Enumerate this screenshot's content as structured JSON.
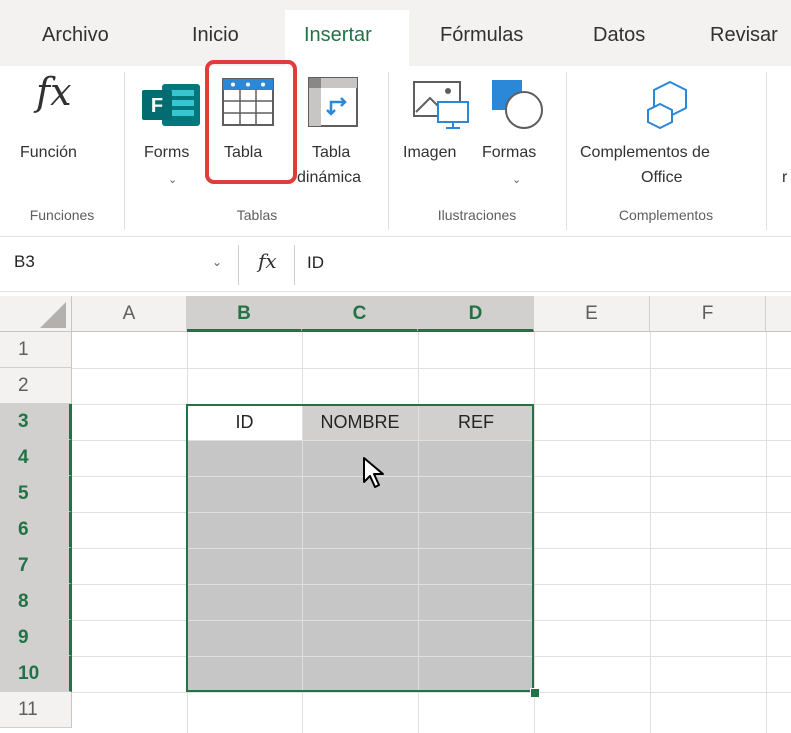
{
  "tabs": [
    {
      "label": "Archivo",
      "active": false
    },
    {
      "label": "Inicio",
      "active": false
    },
    {
      "label": "Insertar",
      "active": true
    },
    {
      "label": "Fórmulas",
      "active": false
    },
    {
      "label": "Datos",
      "active": false
    },
    {
      "label": "Revisar",
      "active": false
    }
  ],
  "ribbon": {
    "funcion": {
      "label": "Función",
      "group": "Funciones"
    },
    "forms": {
      "label": "Forms"
    },
    "tabla": {
      "label": "Tabla"
    },
    "tabla_dinamica": {
      "label_line1": "Tabla",
      "label_line2": "dinámica"
    },
    "tablas_group": "Tablas",
    "imagen": {
      "label": "Imagen"
    },
    "formas": {
      "label": "Formas"
    },
    "ilustraciones_group": "Ilustraciones",
    "complementos": {
      "label_line1": "Complementos de",
      "label_line2": "Office"
    },
    "complementos_group": "Complementos",
    "cut_label": "r"
  },
  "formula_bar": {
    "name_box": "B3",
    "fx": "fx",
    "value": "ID"
  },
  "columns": [
    "A",
    "B",
    "C",
    "D",
    "E",
    "F"
  ],
  "rows": [
    "1",
    "2",
    "3",
    "4",
    "5",
    "6",
    "7",
    "8",
    "9",
    "10",
    "11"
  ],
  "cells": {
    "B3": "ID",
    "C3": "NOMBRE",
    "D3": "REF"
  },
  "colors": {
    "accent_green": "#217346",
    "highlight_red": "#e03c3c",
    "selection_fill": "#c6c6c6"
  }
}
